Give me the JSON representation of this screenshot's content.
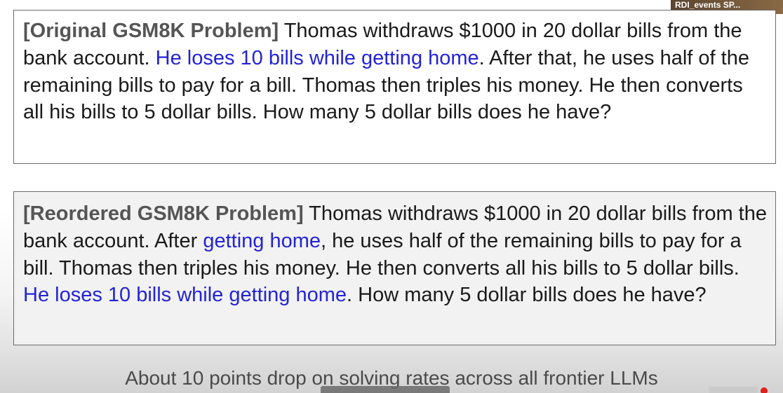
{
  "video_overlay": {
    "channel_label": "RDI_events SP..."
  },
  "original": {
    "tag": "[Original GSM8K Problem]",
    "text_1": " Thomas withdraws $1000 in 20 dollar bills from the bank account. ",
    "highlight_1": "He loses 10 bills while getting home",
    "text_2": ". After that, he uses half of the remaining bills to pay for a bill. Thomas then triples his money. He then converts all his bills to 5 dollar bills. How many 5 dollar bills does he have?"
  },
  "reordered": {
    "tag": "[Reordered GSM8K Problem]",
    "text_1": " Thomas withdraws $1000 in 20 dollar bills from the bank account. After ",
    "highlight_1": "getting home",
    "text_2": ", he uses half of the remaining bills to pay for a bill. Thomas then triples his money. He then converts all his bills to 5 dollar bills. ",
    "highlight_2": "He loses 10 bills while getting home",
    "text_3": ". How many 5 dollar bills does he have?"
  },
  "caption": "About 10 points drop on solving rates across all frontier LLMs",
  "colors": {
    "highlight": "#2323d6",
    "tag": "#555555",
    "body_text": "#1a1a1a"
  }
}
